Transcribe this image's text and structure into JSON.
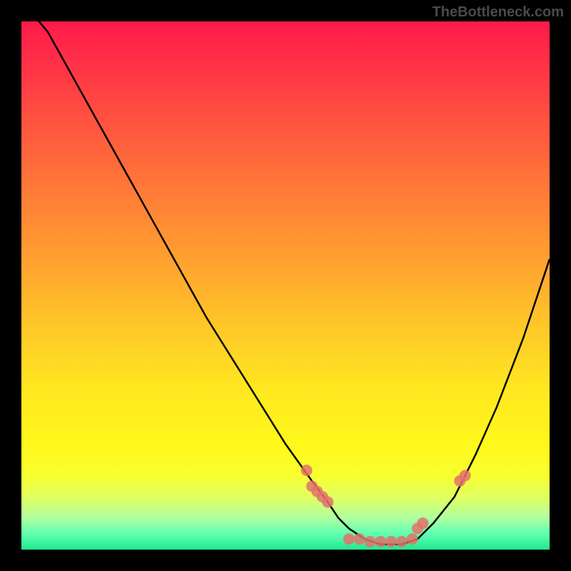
{
  "watermark": "TheBottleneck.com",
  "chart_data": {
    "type": "line",
    "title": "",
    "xlabel": "",
    "ylabel": "",
    "xlim": [
      0,
      100
    ],
    "ylim": [
      0,
      100
    ],
    "curve": {
      "name": "bottleneck-curve",
      "x": [
        0,
        5,
        10,
        15,
        20,
        25,
        30,
        35,
        40,
        45,
        50,
        55,
        58,
        60,
        62,
        65,
        68,
        72,
        75,
        78,
        82,
        86,
        90,
        95,
        100
      ],
      "y": [
        104,
        98,
        89,
        80,
        71,
        62,
        53,
        44,
        36,
        28,
        20,
        13,
        9,
        6,
        4,
        2,
        1,
        1,
        2,
        5,
        10,
        18,
        27,
        40,
        55
      ]
    },
    "scatter": {
      "name": "data-points",
      "color": "#e4716b",
      "points": [
        {
          "x": 54,
          "y": 15
        },
        {
          "x": 55,
          "y": 12
        },
        {
          "x": 56,
          "y": 11
        },
        {
          "x": 57,
          "y": 10
        },
        {
          "x": 58,
          "y": 9
        },
        {
          "x": 62,
          "y": 2
        },
        {
          "x": 64,
          "y": 2
        },
        {
          "x": 66,
          "y": 1.5
        },
        {
          "x": 68,
          "y": 1.5
        },
        {
          "x": 70,
          "y": 1.5
        },
        {
          "x": 72,
          "y": 1.5
        },
        {
          "x": 74,
          "y": 2
        },
        {
          "x": 75,
          "y": 4
        },
        {
          "x": 76,
          "y": 5
        },
        {
          "x": 83,
          "y": 13
        },
        {
          "x": 84,
          "y": 14
        }
      ]
    },
    "gradient_stops": [
      {
        "pos": 0,
        "color": "#ff1a4a"
      },
      {
        "pos": 50,
        "color": "#ffb028"
      },
      {
        "pos": 80,
        "color": "#fff81a"
      },
      {
        "pos": 100,
        "color": "#20e890"
      }
    ]
  }
}
